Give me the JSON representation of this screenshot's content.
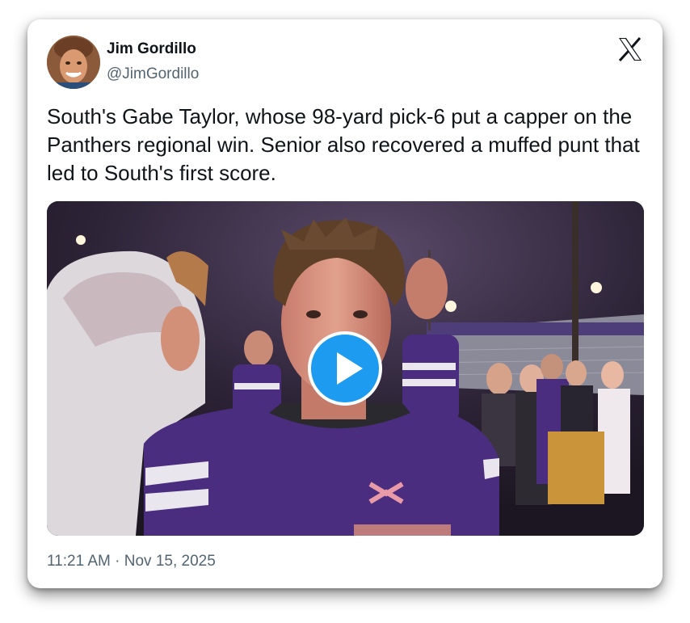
{
  "tweet": {
    "author_name": "Jim Gordillo",
    "author_handle": "@JimGordillo",
    "text": "South's Gabe Taylor, whose 98-yard pick-6 put a capper on the Panthers regional win. Senior also recovered a muffed punt that led to South's first score.",
    "timestamp": "11:21 AM · Nov 15, 2025"
  },
  "icons": {
    "brand": "x-logo-icon",
    "media_overlay": "play-icon"
  },
  "colors": {
    "text_primary": "#0f1419",
    "text_secondary": "#536471",
    "play_button": "#1d9bf0",
    "jersey_purple": "#4b2d7f"
  }
}
